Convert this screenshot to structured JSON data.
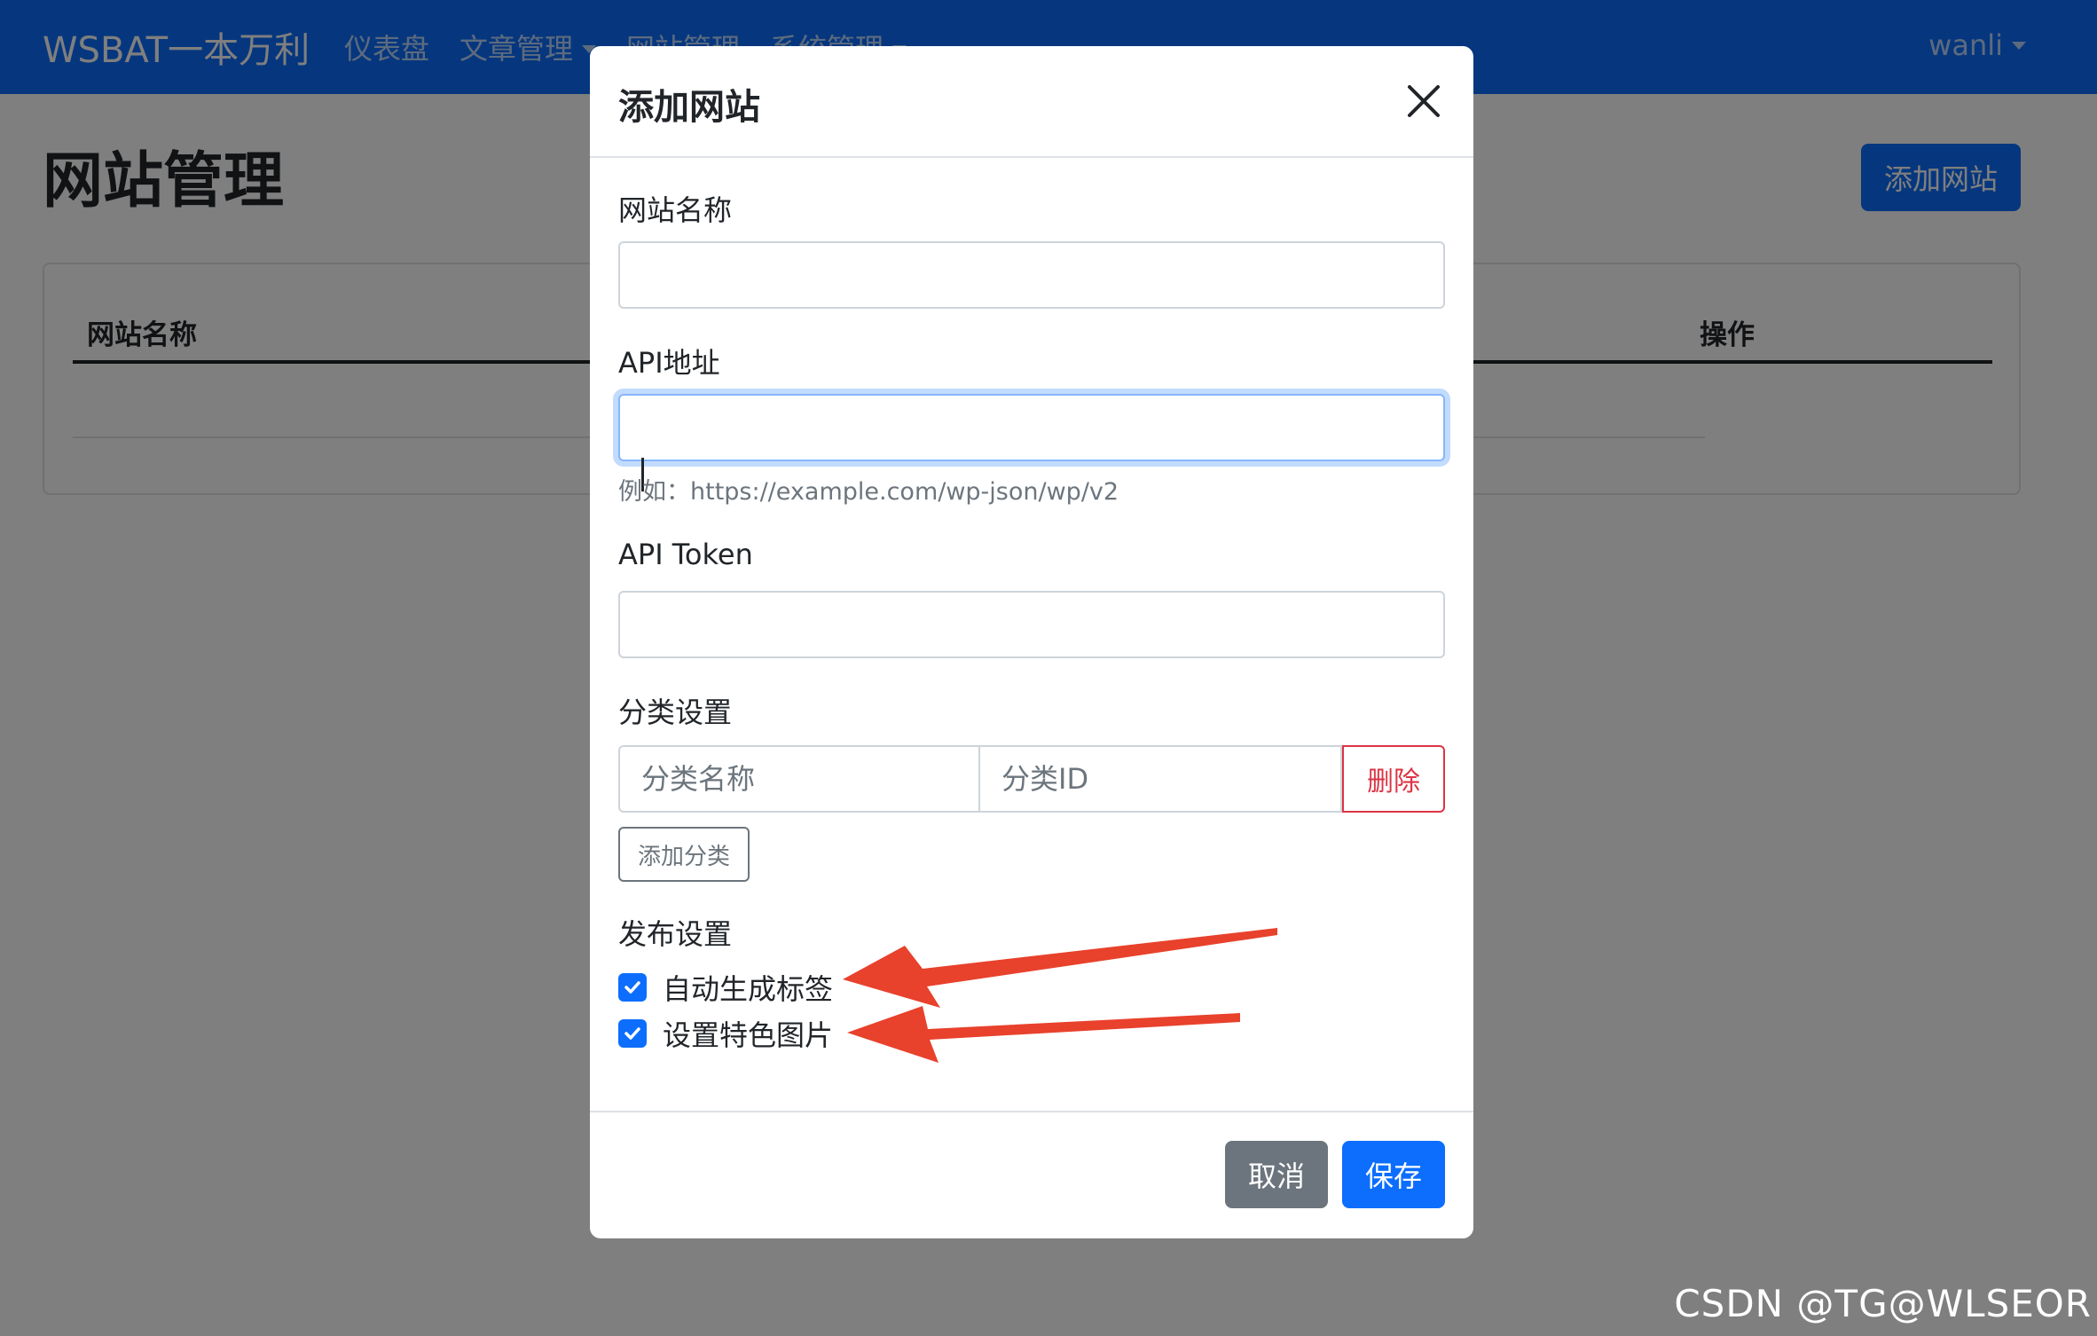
{
  "navbar": {
    "brand": "WSBAT一本万利",
    "links": [
      "仪表盘",
      "文章管理",
      "网站管理",
      "系统管理"
    ],
    "user": "wanli"
  },
  "page": {
    "title": "网站管理",
    "add_button": "添加网站",
    "table": {
      "headers": {
        "name": "网站名称",
        "actions": "操作"
      }
    }
  },
  "modal": {
    "title": "添加网站",
    "fields": {
      "site_name": {
        "label": "网站名称",
        "value": ""
      },
      "api_url": {
        "label": "API地址",
        "value": "",
        "help": "例如：https://example.com/wp-json/wp/v2"
      },
      "api_token": {
        "label": "API Token",
        "value": ""
      }
    },
    "categories": {
      "label": "分类设置",
      "name_placeholder": "分类名称",
      "id_placeholder": "分类ID",
      "delete_label": "删除",
      "add_label": "添加分类"
    },
    "publish": {
      "label": "发布设置",
      "options": [
        {
          "label": "自动生成标签",
          "checked": true
        },
        {
          "label": "设置特色图片",
          "checked": true
        }
      ]
    },
    "footer": {
      "cancel": "取消",
      "save": "保存"
    }
  },
  "colors": {
    "primary": "#0d6efd",
    "danger": "#dc3545",
    "secondary": "#6c757d",
    "annotation_arrow": "#e8412c"
  },
  "watermark": "CSDN @TG@WLSEOR"
}
